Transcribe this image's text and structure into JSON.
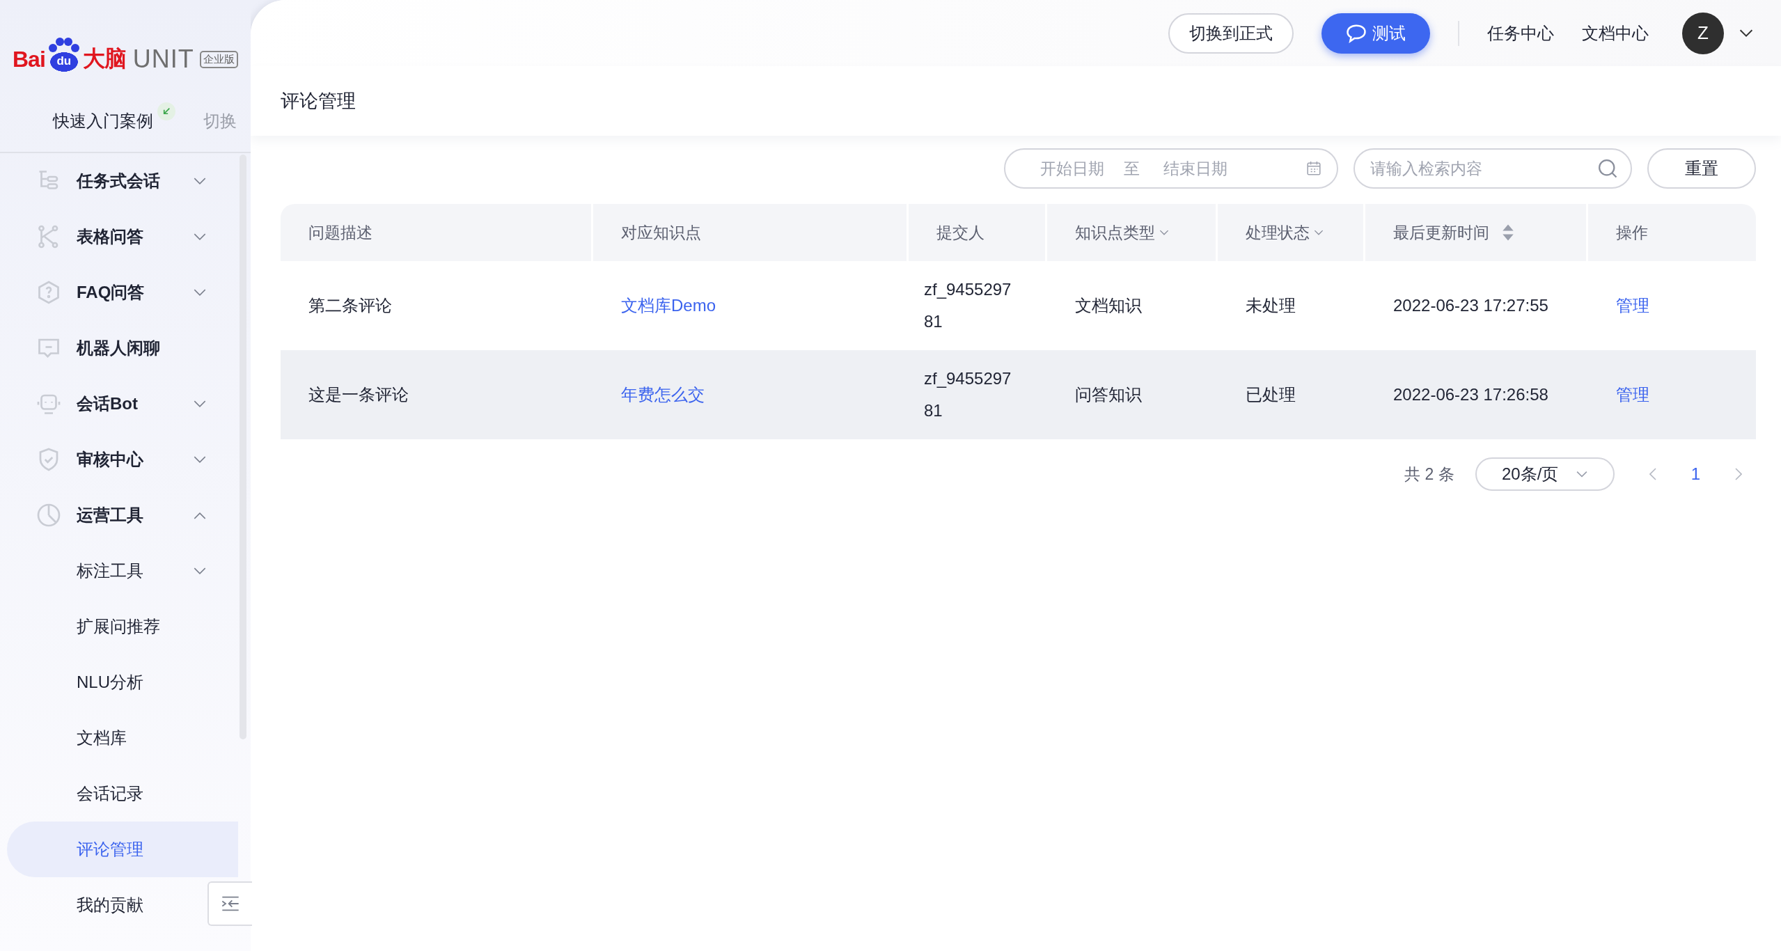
{
  "logo": {
    "brand": "Bai",
    "mark": "du",
    "name": "大脑",
    "product": "UNIT",
    "edition": "企业版"
  },
  "sidebar": {
    "project": "快速入门案例",
    "switch": "切换",
    "items": [
      {
        "label": "任务式会话",
        "expanded": false,
        "selected": false
      },
      {
        "label": "表格问答",
        "expanded": false,
        "selected": false
      },
      {
        "label": "FAQ问答",
        "expanded": false,
        "selected": false
      },
      {
        "label": "机器人闲聊",
        "selected": false
      },
      {
        "label": "会话Bot",
        "expanded": false,
        "selected": false
      },
      {
        "label": "审核中心",
        "expanded": false,
        "selected": false
      },
      {
        "label": "运营工具",
        "expanded": true,
        "selected": false,
        "children": [
          {
            "label": "标注工具",
            "expanded": false,
            "selected": false
          },
          {
            "label": "扩展问推荐",
            "selected": false
          },
          {
            "label": "NLU分析",
            "selected": false
          },
          {
            "label": "文档库",
            "selected": false
          },
          {
            "label": "会话记录",
            "selected": false
          },
          {
            "label": "评论管理",
            "selected": true
          },
          {
            "label": "我的贡献",
            "selected": false
          }
        ]
      }
    ]
  },
  "header": {
    "switch_button": "切换到正式",
    "test_button": "测试",
    "links": [
      "任务中心",
      "文档中心"
    ],
    "avatar": "Z"
  },
  "page_title": "评论管理",
  "filters": {
    "start_placeholder": "开始日期",
    "separator": "至",
    "end_placeholder": "结束日期",
    "search_placeholder": "请输入检索内容",
    "reset": "重置"
  },
  "table": {
    "columns": [
      {
        "label": "问题描述",
        "kind": "plain"
      },
      {
        "label": "对应知识点",
        "kind": "plain"
      },
      {
        "label": "提交人",
        "kind": "plain"
      },
      {
        "label": "知识点类型",
        "kind": "filter"
      },
      {
        "label": "处理状态",
        "kind": "filter"
      },
      {
        "label": "最后更新时间",
        "kind": "sort"
      },
      {
        "label": "操作",
        "kind": "plain"
      }
    ],
    "rows": [
      {
        "highlighted": false,
        "cells": [
          "第二条评论",
          "文档库Demo",
          "zf_945529781",
          "文档知识",
          "未处理",
          "2022-06-23 17:27:55",
          "管理"
        ]
      },
      {
        "highlighted": true,
        "cells": [
          "这是一条评论",
          "年费怎么交",
          "zf_945529781",
          "问答知识",
          "已处理",
          "2022-06-23 17:26:58",
          "管理"
        ]
      }
    ]
  },
  "pagination": {
    "total": "共 2 条",
    "page_size": "20条/页",
    "pages": [
      {
        "label": "1",
        "selected": true
      }
    ]
  }
}
